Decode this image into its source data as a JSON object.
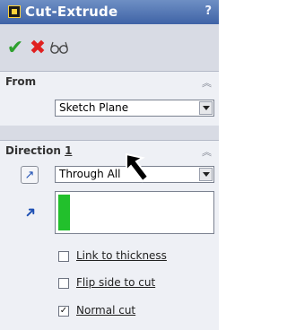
{
  "window": {
    "title": "Cut-Extrude",
    "help": "?"
  },
  "toolbar": {
    "ok_icon": "checkmark-icon",
    "cancel_icon": "x-icon",
    "detail_icon": "glasses-icon"
  },
  "from_group": {
    "title": "From",
    "value": "Sketch Plane"
  },
  "direction_group": {
    "title_prefix": "Direction ",
    "title_number": "1",
    "end_condition": "Through All",
    "options": [
      {
        "label": "Link to thickness",
        "checked": false
      },
      {
        "label": "Flip side to cut",
        "checked": false
      },
      {
        "label": "Normal cut",
        "checked": true
      }
    ]
  },
  "colors": {
    "title_bar": "#4b6fae",
    "accept": "#2ea02e",
    "cancel": "#e02020",
    "selection": "#22c02c"
  }
}
